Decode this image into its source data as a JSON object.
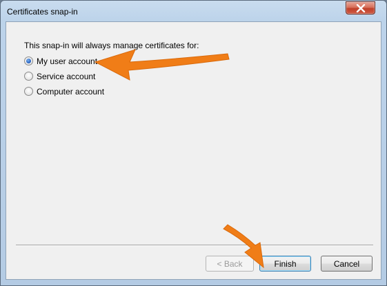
{
  "window": {
    "title": "Certificates snap-in",
    "close_icon": "close-icon"
  },
  "content": {
    "intro": "This snap-in will always manage certificates for:",
    "options": [
      {
        "label": "My user account",
        "checked": true
      },
      {
        "label": "Service account",
        "checked": false
      },
      {
        "label": "Computer account",
        "checked": false
      }
    ]
  },
  "buttons": {
    "back": "< Back",
    "finish": "Finish",
    "cancel": "Cancel"
  },
  "colors": {
    "annotation_arrow": "#f07d17"
  }
}
